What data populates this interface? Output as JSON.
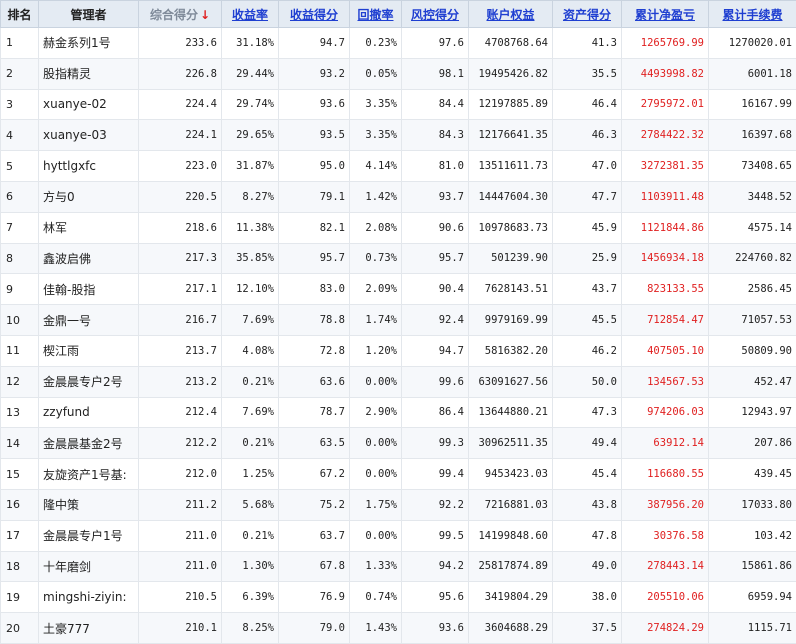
{
  "colors": {
    "accent_link": "#1f3fd1",
    "profit_red": "#e02020",
    "header_bg": "#e4ebf3",
    "sorted_header": "#7f8a99"
  },
  "headers": {
    "rank": "排名",
    "manager": "管理者",
    "total_score": "综合得分",
    "total_score_sort_icon": "down-arrow-icon",
    "return_rate": "收益率",
    "return_score": "收益得分",
    "drawdown": "回撤率",
    "risk_score": "风控得分",
    "equity": "账户权益",
    "asset_score": "资产得分",
    "cum_profit": "累计净盈亏",
    "cum_fee": "累计手续费"
  },
  "sort_arrow": "↓",
  "rows": [
    {
      "rank": "1",
      "manager": "赫金系列1号",
      "total_score": "233.6",
      "return_rate": "31.18%",
      "return_score": "94.7",
      "drawdown": "0.23%",
      "risk_score": "97.6",
      "equity": "4708768.64",
      "asset_score": "41.3",
      "cum_profit": "1265769.99",
      "cum_fee": "1270020.01"
    },
    {
      "rank": "2",
      "manager": "股指精灵",
      "total_score": "226.8",
      "return_rate": "29.44%",
      "return_score": "93.2",
      "drawdown": "0.05%",
      "risk_score": "98.1",
      "equity": "19495426.82",
      "asset_score": "35.5",
      "cum_profit": "4493998.82",
      "cum_fee": "6001.18"
    },
    {
      "rank": "3",
      "manager": "xuanye-02",
      "total_score": "224.4",
      "return_rate": "29.74%",
      "return_score": "93.6",
      "drawdown": "3.35%",
      "risk_score": "84.4",
      "equity": "12197885.89",
      "asset_score": "46.4",
      "cum_profit": "2795972.01",
      "cum_fee": "16167.99"
    },
    {
      "rank": "4",
      "manager": "xuanye-03",
      "total_score": "224.1",
      "return_rate": "29.65%",
      "return_score": "93.5",
      "drawdown": "3.35%",
      "risk_score": "84.3",
      "equity": "12176641.35",
      "asset_score": "46.3",
      "cum_profit": "2784422.32",
      "cum_fee": "16397.68"
    },
    {
      "rank": "5",
      "manager": "hyttlgxfc",
      "total_score": "223.0",
      "return_rate": "31.87%",
      "return_score": "95.0",
      "drawdown": "4.14%",
      "risk_score": "81.0",
      "equity": "13511611.73",
      "asset_score": "47.0",
      "cum_profit": "3272381.35",
      "cum_fee": "73408.65"
    },
    {
      "rank": "6",
      "manager": "方与0",
      "total_score": "220.5",
      "return_rate": "8.27%",
      "return_score": "79.1",
      "drawdown": "1.42%",
      "risk_score": "93.7",
      "equity": "14447604.30",
      "asset_score": "47.7",
      "cum_profit": "1103911.48",
      "cum_fee": "3448.52"
    },
    {
      "rank": "7",
      "manager": "林军",
      "total_score": "218.6",
      "return_rate": "11.38%",
      "return_score": "82.1",
      "drawdown": "2.08%",
      "risk_score": "90.6",
      "equity": "10978683.73",
      "asset_score": "45.9",
      "cum_profit": "1121844.86",
      "cum_fee": "4575.14"
    },
    {
      "rank": "8",
      "manager": "鑫波启佛",
      "total_score": "217.3",
      "return_rate": "35.85%",
      "return_score": "95.7",
      "drawdown": "0.73%",
      "risk_score": "95.7",
      "equity": "501239.90",
      "asset_score": "25.9",
      "cum_profit": "1456934.18",
      "cum_fee": "224760.82"
    },
    {
      "rank": "9",
      "manager": "佳翰-股指",
      "total_score": "217.1",
      "return_rate": "12.10%",
      "return_score": "83.0",
      "drawdown": "2.09%",
      "risk_score": "90.4",
      "equity": "7628143.51",
      "asset_score": "43.7",
      "cum_profit": "823133.55",
      "cum_fee": "2586.45"
    },
    {
      "rank": "10",
      "manager": "金鼎一号",
      "total_score": "216.7",
      "return_rate": "7.69%",
      "return_score": "78.8",
      "drawdown": "1.74%",
      "risk_score": "92.4",
      "equity": "9979169.99",
      "asset_score": "45.5",
      "cum_profit": "712854.47",
      "cum_fee": "71057.53"
    },
    {
      "rank": "11",
      "manager": "楔江雨",
      "total_score": "213.7",
      "return_rate": "4.08%",
      "return_score": "72.8",
      "drawdown": "1.20%",
      "risk_score": "94.7",
      "equity": "5816382.20",
      "asset_score": "46.2",
      "cum_profit": "407505.10",
      "cum_fee": "50809.90"
    },
    {
      "rank": "12",
      "manager": "金晨晨专户2号",
      "total_score": "213.2",
      "return_rate": "0.21%",
      "return_score": "63.6",
      "drawdown": "0.00%",
      "risk_score": "99.6",
      "equity": "63091627.56",
      "asset_score": "50.0",
      "cum_profit": "134567.53",
      "cum_fee": "452.47"
    },
    {
      "rank": "13",
      "manager": "zzyfund",
      "total_score": "212.4",
      "return_rate": "7.69%",
      "return_score": "78.7",
      "drawdown": "2.90%",
      "risk_score": "86.4",
      "equity": "13644880.21",
      "asset_score": "47.3",
      "cum_profit": "974206.03",
      "cum_fee": "12943.97"
    },
    {
      "rank": "14",
      "manager": "金晨晨基金2号",
      "total_score": "212.2",
      "return_rate": "0.21%",
      "return_score": "63.5",
      "drawdown": "0.00%",
      "risk_score": "99.3",
      "equity": "30962511.35",
      "asset_score": "49.4",
      "cum_profit": "63912.14",
      "cum_fee": "207.86"
    },
    {
      "rank": "15",
      "manager": "友旋资产1号基:",
      "total_score": "212.0",
      "return_rate": "1.25%",
      "return_score": "67.2",
      "drawdown": "0.00%",
      "risk_score": "99.4",
      "equity": "9453423.03",
      "asset_score": "45.4",
      "cum_profit": "116680.55",
      "cum_fee": "439.45"
    },
    {
      "rank": "16",
      "manager": "隆中策",
      "total_score": "211.2",
      "return_rate": "5.68%",
      "return_score": "75.2",
      "drawdown": "1.75%",
      "risk_score": "92.2",
      "equity": "7216881.03",
      "asset_score": "43.8",
      "cum_profit": "387956.20",
      "cum_fee": "17033.80"
    },
    {
      "rank": "17",
      "manager": "金晨晨专户1号",
      "total_score": "211.0",
      "return_rate": "0.21%",
      "return_score": "63.7",
      "drawdown": "0.00%",
      "risk_score": "99.5",
      "equity": "14199848.60",
      "asset_score": "47.8",
      "cum_profit": "30376.58",
      "cum_fee": "103.42"
    },
    {
      "rank": "18",
      "manager": "十年磨剑",
      "total_score": "211.0",
      "return_rate": "1.30%",
      "return_score": "67.8",
      "drawdown": "1.33%",
      "risk_score": "94.2",
      "equity": "25817874.89",
      "asset_score": "49.0",
      "cum_profit": "278443.14",
      "cum_fee": "15861.86"
    },
    {
      "rank": "19",
      "manager": "mingshi-ziyin:",
      "total_score": "210.5",
      "return_rate": "6.39%",
      "return_score": "76.9",
      "drawdown": "0.74%",
      "risk_score": "95.6",
      "equity": "3419804.29",
      "asset_score": "38.0",
      "cum_profit": "205510.06",
      "cum_fee": "6959.94"
    },
    {
      "rank": "20",
      "manager": "土豪777",
      "total_score": "210.1",
      "return_rate": "8.25%",
      "return_score": "79.0",
      "drawdown": "1.43%",
      "risk_score": "93.6",
      "equity": "3604688.29",
      "asset_score": "37.5",
      "cum_profit": "274824.29",
      "cum_fee": "1115.71"
    }
  ]
}
